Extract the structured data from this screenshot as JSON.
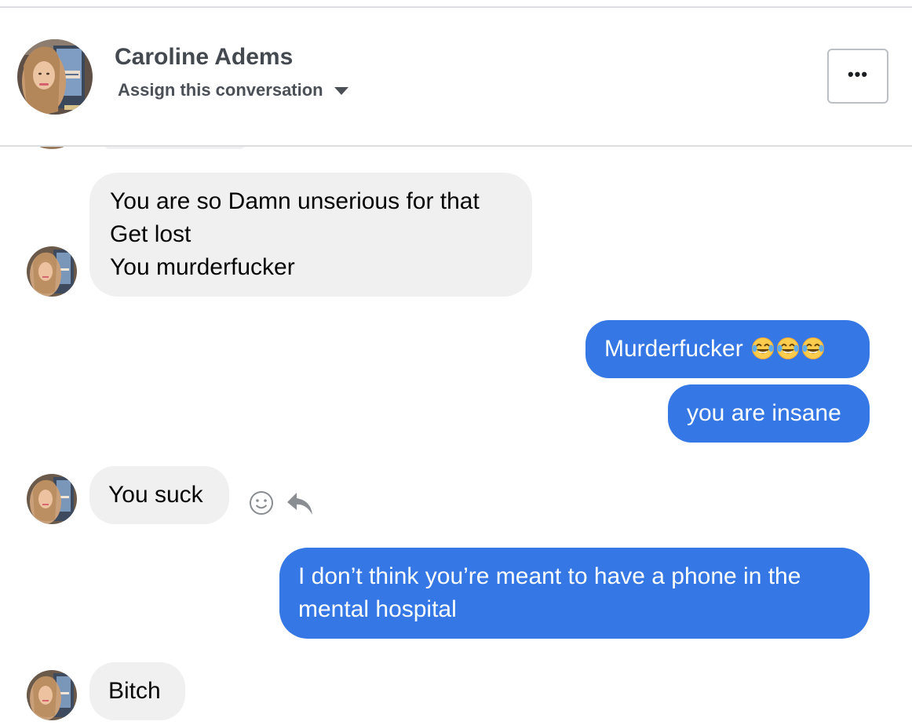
{
  "conversation": {
    "contact_name": "Caroline Adems",
    "assign_label": "Assign this conversation",
    "more_label": "•••"
  },
  "messages": [
    {
      "direction": "incoming",
      "lines": [
        "You are so Damn unserious for that",
        "Get lost",
        "You murderfucker"
      ]
    },
    {
      "direction": "outgoing",
      "text": "Murderfucker",
      "emoji": [
        "face-with-tears-of-joy",
        "face-with-tears-of-joy",
        "face-with-tears-of-joy"
      ]
    },
    {
      "direction": "outgoing",
      "text": "you are insane"
    },
    {
      "direction": "incoming",
      "text": "You suck"
    },
    {
      "direction": "outgoing",
      "lines": [
        "I don’t think you’re meant to have a phone in the",
        "mental hospital"
      ]
    },
    {
      "direction": "incoming",
      "text": "Bitch"
    }
  ],
  "icons": {
    "more": "more-options-icon",
    "caret": "caret-down-icon",
    "react": "smiley-react-icon",
    "reply": "reply-arrow-icon"
  },
  "colors": {
    "outgoing_bubble": "#3578e5",
    "incoming_bubble": "#f0f0f0",
    "header_text": "#444950"
  }
}
